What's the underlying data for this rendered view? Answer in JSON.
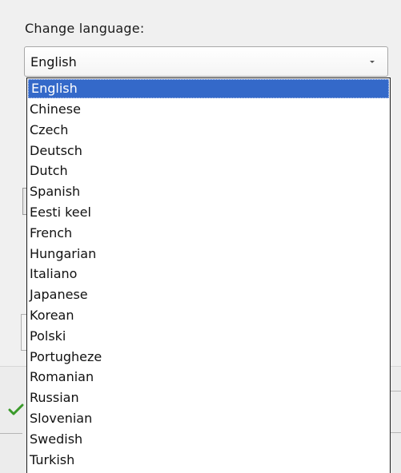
{
  "language_section": {
    "label": "Change language:",
    "selected_value": "English"
  },
  "dropdown": {
    "options": [
      "English",
      "Chinese",
      "Czech",
      "Deutsch",
      "Dutch",
      "Spanish",
      "Eesti keel",
      "French",
      "Hungarian",
      "Italiano",
      "Japanese",
      "Korean",
      "Polski",
      "Portugheze",
      "Romanian",
      "Russian",
      "Slovenian",
      "Swedish",
      "Turkish"
    ],
    "selected_index": 0
  },
  "colors": {
    "selection_bg": "#3469c9",
    "check_green": "#3a9a2a"
  },
  "icons": {
    "dropdown_arrow": "chevron-down-icon",
    "confirm": "check-icon"
  }
}
